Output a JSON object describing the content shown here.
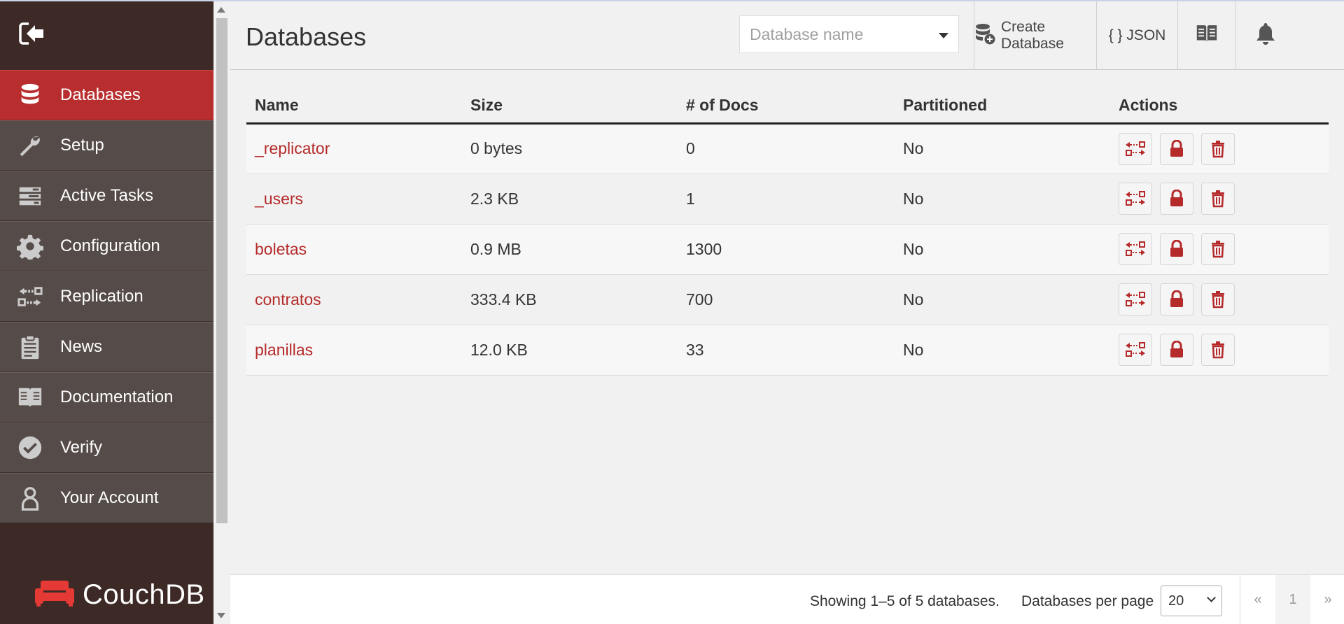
{
  "sidebar": {
    "collapse_icon": "sign-out-icon",
    "items": [
      {
        "label": "Databases",
        "icon": "database-icon",
        "active": true
      },
      {
        "label": "Setup",
        "icon": "wrench-icon"
      },
      {
        "label": "Active Tasks",
        "icon": "tasks-icon"
      },
      {
        "label": "Configuration",
        "icon": "gear-icon"
      },
      {
        "label": "Replication",
        "icon": "replication-icon"
      },
      {
        "label": "News",
        "icon": "clipboard-icon"
      },
      {
        "label": "Documentation",
        "icon": "book-icon"
      },
      {
        "label": "Verify",
        "icon": "check-circle-icon"
      },
      {
        "label": "Your Account",
        "icon": "user-icon"
      }
    ],
    "logo_text": "CouchDB"
  },
  "header": {
    "title": "Databases",
    "search_placeholder": "Database name",
    "create_label": "Create Database",
    "json_label": "{ } JSON"
  },
  "table": {
    "columns": [
      "Name",
      "Size",
      "# of Docs",
      "Partitioned",
      "Actions"
    ],
    "rows": [
      {
        "name": "_replicator",
        "size": "0 bytes",
        "docs": "0",
        "partitioned": "No"
      },
      {
        "name": "_users",
        "size": "2.3 KB",
        "docs": "1",
        "partitioned": "No"
      },
      {
        "name": "boletas",
        "size": "0.9 MB",
        "docs": "1300",
        "partitioned": "No"
      },
      {
        "name": "contratos",
        "size": "333.4 KB",
        "docs": "700",
        "partitioned": "No"
      },
      {
        "name": "planillas",
        "size": "12.0 KB",
        "docs": "33",
        "partitioned": "No"
      }
    ]
  },
  "footer": {
    "showing": "Showing 1–5 of 5 databases.",
    "per_page_label": "Databases per page",
    "per_page_value": "20",
    "pager_prev": "«",
    "pager_page": "1",
    "pager_next": "»"
  },
  "colors": {
    "accent": "#b82e2e",
    "sidebar_bg": "#3d2a27",
    "nav_item_bg": "#554b48",
    "link": "#b52a2a"
  }
}
